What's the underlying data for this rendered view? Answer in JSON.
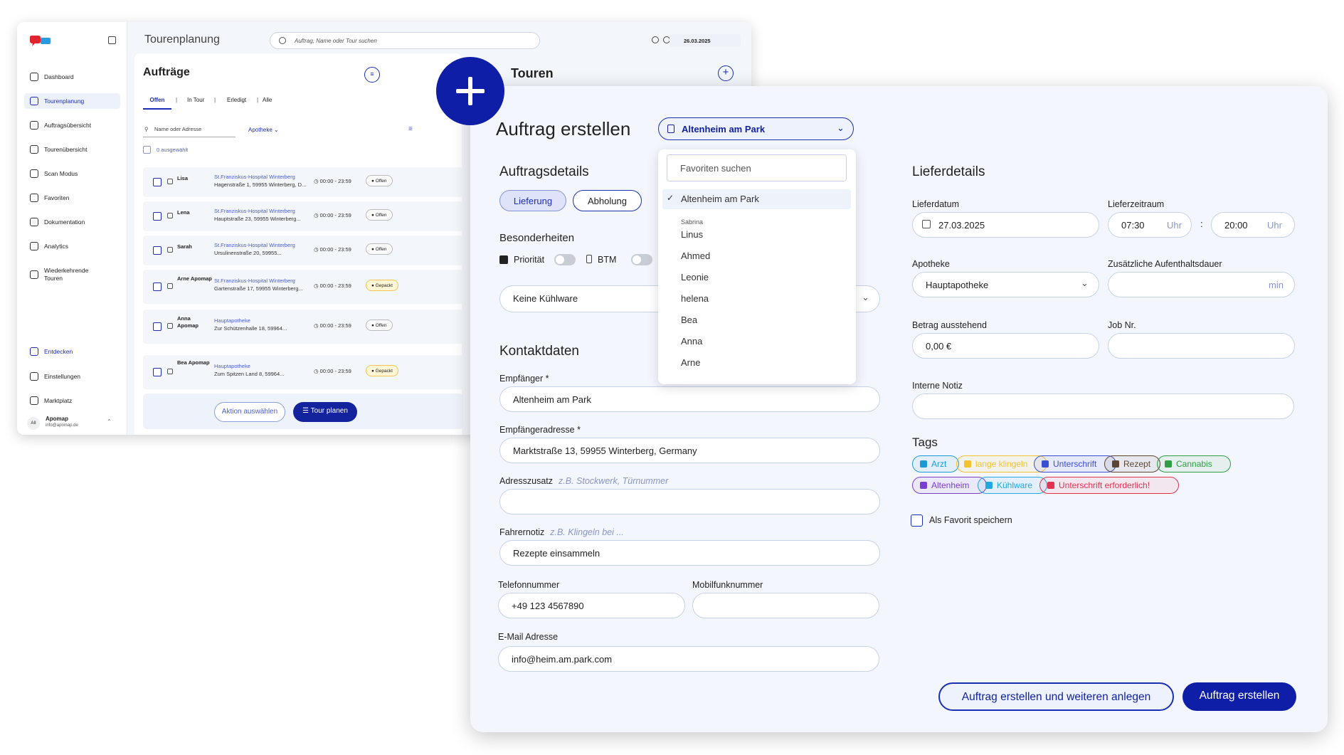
{
  "app": {
    "page_title": "Tourenplanung",
    "search_placeholder": "Auftrag, Name oder Tour suchen",
    "date": "26.03.2025"
  },
  "sidebar": {
    "items": [
      {
        "label": "Dashboard",
        "icon": "grid-icon"
      },
      {
        "label": "Tourenplanung",
        "icon": "route-icon",
        "active": true
      },
      {
        "label": "Auftragsübersicht",
        "icon": "box-icon"
      },
      {
        "label": "Tourenübersicht",
        "icon": "truck-icon"
      },
      {
        "label": "Scan Modus",
        "icon": "scan-icon"
      },
      {
        "label": "Favoriten",
        "icon": "star-icon"
      },
      {
        "label": "Dokumentation",
        "icon": "document-icon"
      },
      {
        "label": "Analytics",
        "icon": "chart-icon"
      },
      {
        "label": "Wiederkehrende Touren",
        "icon": "repeat-icon"
      }
    ],
    "bottom": [
      {
        "label": "Entdecken",
        "icon": "rocket-icon"
      },
      {
        "label": "Einstellungen",
        "icon": "gear-icon"
      },
      {
        "label": "Marktplatz",
        "icon": "store-icon"
      }
    ],
    "user": {
      "initials": "AII",
      "name": "Apomap",
      "email": "info@apomap.de"
    }
  },
  "orders": {
    "title": "Aufträge",
    "tabs": [
      "Offen",
      "In Tour",
      "Erledigt",
      "Alle"
    ],
    "filter_placeholder": "Name oder Adresse",
    "filter_select": "Apotheke",
    "selected_count": "0 ausgewählt",
    "rows": [
      {
        "name": "Lisa",
        "pharmacy": "St.Franziskus-Hospital Winterberg",
        "address": "Hagenstraße 1, 59955 Winterberg, D...",
        "time": "00:00 - 23:59",
        "status": "Offen"
      },
      {
        "name": "Lena",
        "pharmacy": "St.Franziskus-Hospital Winterberg",
        "address": "Hauptstraße 23, 59955 Winterberg...",
        "time": "00:00 - 23:59",
        "status": "Offen"
      },
      {
        "name": "Sarah",
        "pharmacy": "St.Franziskus-Hospital Winterberg",
        "address": "Ursulinenstraße 20, 59955...",
        "time": "00:00 - 23:59",
        "status": "Offen"
      },
      {
        "name": "Arne Apomap",
        "pharmacy": "St.Franziskus-Hospital Winterberg",
        "address": "Gartenstraße 17, 59955 Winterberg...",
        "time": "00:00 - 23:59",
        "status": "Gepackt"
      },
      {
        "name": "Anna Apomap",
        "pharmacy": "Hauptapotheke",
        "address": "Zur Schützenhalle 18, 59964...",
        "time": "00:00 - 23:59",
        "status": "Offen"
      },
      {
        "name": "Bea Apomap",
        "pharmacy": "Hauptapotheke",
        "address": "Zum Spitzen Land 8, 59964...",
        "time": "00:00 - 23:59",
        "status": "Gepackt"
      }
    ],
    "action_button": "Aktion auswählen",
    "plan_button": "Tour planen"
  },
  "tours": {
    "title": "Touren"
  },
  "modal": {
    "title": "Auftrag erstellen",
    "preset": "Altenheim am Park",
    "order_details": {
      "heading": "Auftragsdetails",
      "types": [
        "Lieferung",
        "Abholung"
      ],
      "special_heading": "Besonderheiten",
      "priority": "Priorität",
      "btm": "BTM",
      "cooling": "Keine Kühlware"
    },
    "contact": {
      "heading": "Kontaktdaten",
      "recipient_label": "Empfänger *",
      "recipient": "Altenheim am Park",
      "address_label": "Empfängeradresse *",
      "address": "Marktstraße 13, 59955 Winterberg, Germany",
      "extra_label": "Adresszusatz",
      "extra_hint": "z.B. Stockwerk, Türnummer",
      "extra": "",
      "driver_label": "Fahrernotiz",
      "driver_hint": "z.B. Klingeln bei ...",
      "driver": "Rezepte einsammeln",
      "phone_label": "Telefonnummer",
      "phone": "+49 123 4567890",
      "mobile_label": "Mobilfunknummer",
      "mobile": "",
      "email_label": "E-Mail Adresse",
      "email": "info@heim.am.park.com"
    },
    "delivery": {
      "heading": "Lieferdetails",
      "date_label": "Lieferdatum",
      "date": "27.03.2025",
      "window_label": "Lieferzeitraum",
      "from": "07:30",
      "to": "20:00",
      "unit": "Uhr",
      "sep": ":",
      "pharmacy_label": "Apotheke",
      "pharmacy": "Hauptapotheke",
      "stay_label": "Zusätzliche Aufenthaltsdauer",
      "stay_unit": "min",
      "amount_label": "Betrag ausstehend",
      "amount": "0,00 €",
      "job_label": "Job Nr.",
      "note_label": "Interne Notiz",
      "tags_heading": "Tags",
      "tags": [
        {
          "label": "Arzt",
          "color": "#1a9ad6"
        },
        {
          "label": "lange klingeln",
          "color": "#f2c230"
        },
        {
          "label": "Unterschrift",
          "color": "#3b4fd0"
        },
        {
          "label": "Rezept",
          "color": "#5b4634"
        },
        {
          "label": "Cannabis",
          "color": "#2f9e44"
        },
        {
          "label": "Altenheim",
          "color": "#7a3fd0"
        },
        {
          "label": "Kühlware",
          "color": "#22a7e0"
        },
        {
          "label": "Unterschrift erforderlich!",
          "color": "#e0334f"
        }
      ],
      "favorite_label": "Als Favorit speichern"
    },
    "buttons": {
      "create_more": "Auftrag erstellen und weiteren anlegen",
      "create": "Auftrag erstellen"
    }
  },
  "dropdown": {
    "search_placeholder": "Favoriten suchen",
    "selected": "Altenheim am Park",
    "group": "Sabrina",
    "items": [
      "Linus",
      "Ahmed",
      "Leonie",
      "helena",
      "Bea",
      "Anna",
      "Arne"
    ]
  }
}
